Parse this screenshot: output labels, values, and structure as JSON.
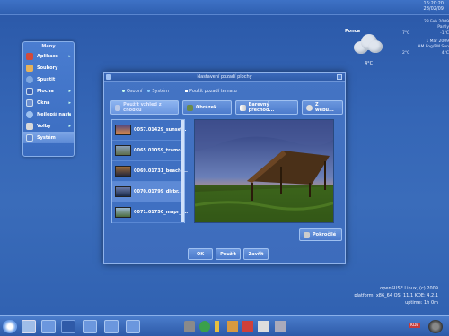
{
  "clock": {
    "time": "16:20:20",
    "date": "28/02/09"
  },
  "weather": {
    "city": "Ponca",
    "temp_now": "4°C",
    "right_rows": [
      "28 Feb 2009",
      "Partly",
      "Cloudy"
    ],
    "right_temps": [
      "7°C",
      "-1°C"
    ],
    "right_rows2": [
      "1 Mar 2009",
      "AM Fog/PM Sun"
    ],
    "right_temps2": [
      "2°C",
      "4°C"
    ]
  },
  "menu": {
    "title": "Meny",
    "items": [
      {
        "label": "Aplikace",
        "arrow": "▸",
        "color": "#d34a3a"
      },
      {
        "label": "Soubory",
        "arrow": "",
        "color": "#e6b25a"
      },
      {
        "label": "Spustit",
        "arrow": "",
        "color": "#7fa8e0"
      },
      {
        "label": "Plocha",
        "arrow": "▸",
        "color": "#3f63b0"
      },
      {
        "label": "Okna",
        "arrow": "▸",
        "color": "#6d8fce"
      },
      {
        "label": "Nejlepší nastavení",
        "arrow": "▸",
        "color": "#9ec2ef"
      },
      {
        "label": "Volby",
        "arrow": "▸",
        "color": "#d9d9d9"
      },
      {
        "label": "Systém",
        "arrow": "",
        "color": "#5b84cc"
      }
    ]
  },
  "dialog": {
    "title": "Nastavení pozadí plochy",
    "opt_personal": "Osobní",
    "opt_system": "Systém",
    "opt_apply_theme": "Použít pozadí tématu",
    "toolbar": {
      "no_bg": "Použít vzhled z chodku",
      "image": "Obrázek...",
      "gradient": "Barevný přechod...",
      "from_web": "Z webu..."
    },
    "list": [
      {
        "label": "0057.01429_sunset..",
        "grad": "linear-gradient(180deg,#5a4a7a,#d98a4a)"
      },
      {
        "label": "0065.01059_tramon..",
        "grad": "linear-gradient(180deg,#8aa0b8,#5d6d4a)"
      },
      {
        "label": "0069.01731_beachg..",
        "grad": "linear-gradient(180deg,#9a6a3a,#2a2a3a)"
      },
      {
        "label": "0070.01799_dlrbr..",
        "grad": "linear-gradient(180deg,#6a7aa8,#1a2a4a)"
      },
      {
        "label": "0071.01750_mapr_1..",
        "grad": "linear-gradient(180deg,#9ab8d0,#4a6a3a)"
      }
    ],
    "advanced": "Pokročilé",
    "ok": "OK",
    "apply": "Použít",
    "close": "Zavřít"
  },
  "sysinfo": {
    "line1": "openSUSE Linux, (c) 2009",
    "line2": "platform: x86_64 OS: 11.1 KDE: 4.2.1",
    "line3": "uptime: 1h 0m"
  },
  "taskbar": {
    "badge": "KDE"
  }
}
